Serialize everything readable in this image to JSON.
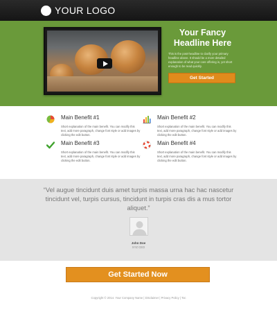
{
  "header": {
    "logo_text": "YOUR LOGO"
  },
  "hero": {
    "headline": "Your Fancy Headline Here",
    "subtext": "This is the post-headline to clarify your primary headline above. It should be a more detailed explanation of what your core offering is, yet short enough to be read quickly.",
    "cta_label": "Get Started",
    "video": {
      "icon": "play-icon"
    }
  },
  "benefits": [
    {
      "title": "Main Benefit #1",
      "text": "Short explanation of the main benefit. You can modify this text, add more paragraph, change font style or add images by clicking the edit button.",
      "icon": "pie-chart-icon"
    },
    {
      "title": "Main Benefit #2",
      "text": "Short explanation of the main benefit. You can modify this text, add more paragraph, change font style or add images by clicking the edit button.",
      "icon": "bar-chart-icon"
    },
    {
      "title": "Main Benefit #3",
      "text": "Short explanation of the main benefit. You can modify this text, add more paragraph, change font style or add images by clicking the edit button.",
      "icon": "checkmark-icon"
    },
    {
      "title": "Main Benefit #4",
      "text": "Short explanation of the main benefit. You can modify this text, add more paragraph, change font style or add images by clicking the edit button.",
      "icon": "lifebuoy-icon"
    }
  ],
  "testimonial": {
    "quote": "“Vel augue tincidunt duis amet turpis massa urna hac hac nascetur tincidunt vel, turpis cursus, tincidunt in turpis cras dis a mus tortor aliquet.”",
    "name": "John Doe",
    "title": "XYZ CEO"
  },
  "main_cta": {
    "label": "Get Started Now"
  },
  "footer": {
    "text": "Copyright © 2014. Your Company Name | Disclaimer | Privacy Policy | Toc"
  },
  "colors": {
    "hero_green": "#6a9a3a",
    "cta_orange": "#e3901f",
    "topbar": "#1e1e1e",
    "testimonial_bg": "#e4e4e4"
  }
}
